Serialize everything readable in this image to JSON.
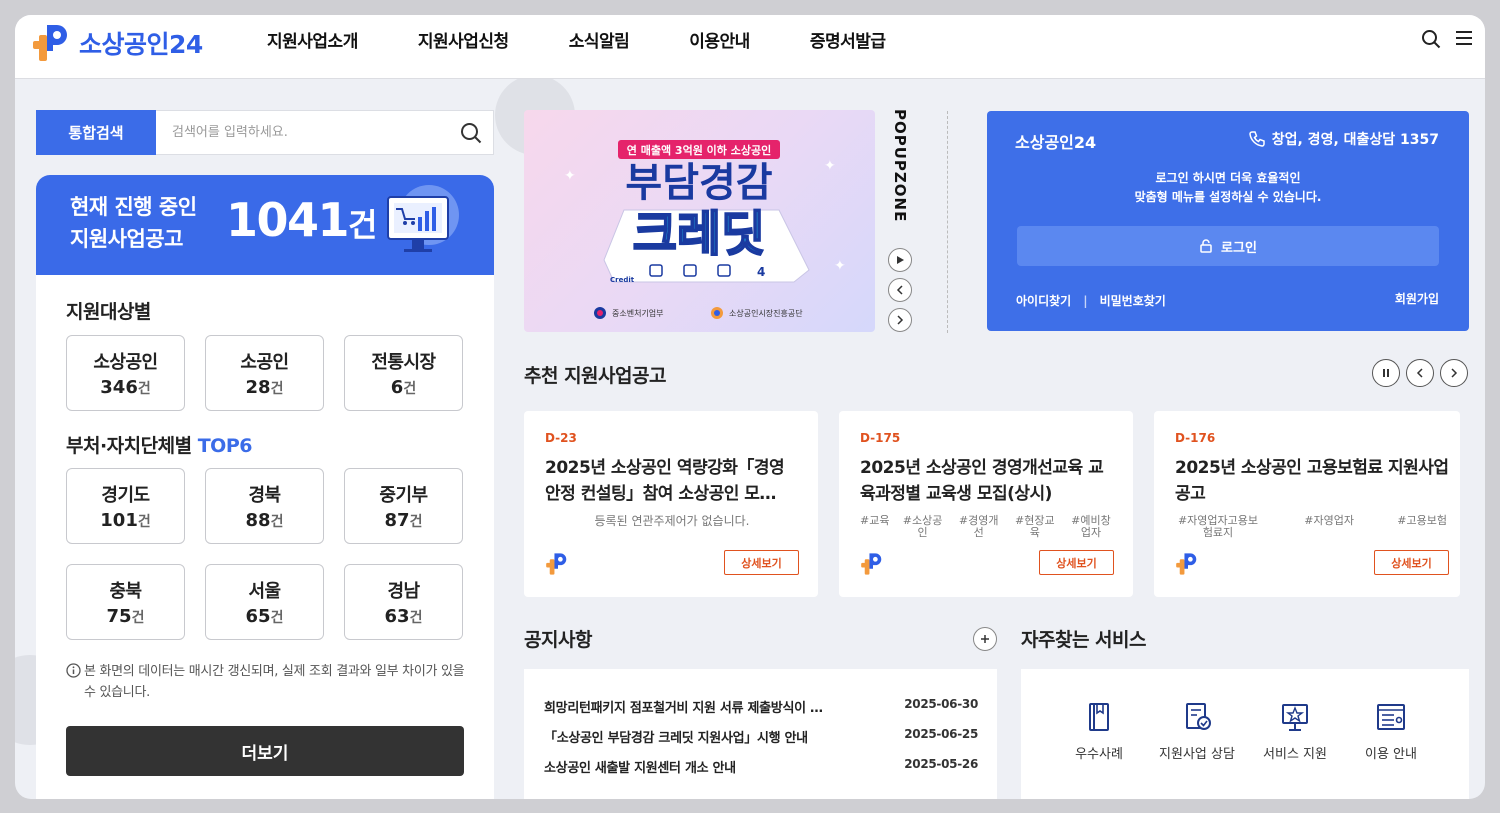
{
  "header": {
    "logo_text": "소상공인24",
    "nav": [
      "지원사업소개",
      "지원사업신청",
      "소식알림",
      "이용안내",
      "증명서발급"
    ],
    "icons": [
      "search-icon",
      "menu-icon"
    ]
  },
  "search": {
    "label": "통합검색",
    "placeholder": "검색어를 입력하세요."
  },
  "ongoing": {
    "label_line1": "현재 진행 중인",
    "label_line2": "지원사업공고",
    "count": "1041",
    "unit": "건"
  },
  "targets": {
    "title": "지원대상별",
    "items": [
      {
        "name": "소상공인",
        "count": "346",
        "unit": "건"
      },
      {
        "name": "소공인",
        "count": "28",
        "unit": "건"
      },
      {
        "name": "전통시장",
        "count": "6",
        "unit": "건"
      }
    ]
  },
  "agencies": {
    "title_prefix": "부처·자치단체별",
    "title_highlight": "TOP6",
    "items": [
      {
        "name": "경기도",
        "count": "101",
        "unit": "건"
      },
      {
        "name": "경북",
        "count": "88",
        "unit": "건"
      },
      {
        "name": "중기부",
        "count": "87",
        "unit": "건"
      },
      {
        "name": "충북",
        "count": "75",
        "unit": "건"
      },
      {
        "name": "서울",
        "count": "65",
        "unit": "건"
      },
      {
        "name": "경남",
        "count": "63",
        "unit": "건"
      }
    ]
  },
  "data_notice": "본 화면의 데이터는 매시간 갱신되며, 실제 조회 결과와 일부 차이가 있을 수 있습니다.",
  "more_button": "더보기",
  "popup": {
    "zone_label": "POPUPZONE",
    "badge": "연 매출액 3억원 이하 소상공인",
    "headline1": "부담경감",
    "headline2": "크레딧",
    "card_text": "Credit",
    "sponsor1": "중소벤처기업부",
    "sponsor2": "소상공인시장진흥공단"
  },
  "login": {
    "brand": "소상공인24",
    "phone": "창업, 경영, 대출상담 1357",
    "message_line1": "로그인 하시면 더욱 효율적인",
    "message_line2": "맞춤형 메뉴를 설정하실 수 있습니다.",
    "button": "로그인",
    "find_id": "아이디찾기",
    "find_pw": "비밀번호찾기",
    "join": "회원가입"
  },
  "recommended": {
    "title": "추천 지원사업공고",
    "cards": [
      {
        "dday": "D-23",
        "title": "2025년 소상공인 역량강화「경영안정 컨설팅」참여 소상공인 모…",
        "tags": [],
        "no_topic": "등록된 연관주제어가 없습니다.",
        "button": "상세보기"
      },
      {
        "dday": "D-175",
        "title": "2025년 소상공인 경영개선교육 교육과정별 교육생 모집(상시)",
        "tags": [
          "#교육",
          "#소상공인",
          "#경영개선",
          "#현장교육",
          "#예비창업자"
        ],
        "no_topic": "",
        "button": "상세보기"
      },
      {
        "dday": "D-176",
        "title": "2025년 소상공인 고용보험료 지원사업 공고",
        "tags": [
          "#자영업자고용보험료지",
          "#자영업자",
          "#고용보험"
        ],
        "no_topic": "",
        "button": "상세보기"
      }
    ]
  },
  "notices": {
    "title": "공지사항",
    "items": [
      {
        "title": "희망리턴패키지 점포철거비 지원 서류 제출방식이 …",
        "date": "2025-06-30"
      },
      {
        "title": "「소상공인 부담경감 크레딧 지원사업」시행 안내",
        "date": "2025-06-25"
      },
      {
        "title": "소상공인 새출발 지원센터 개소 안내",
        "date": "2025-05-26"
      }
    ]
  },
  "services": {
    "title": "자주찾는 서비스",
    "items": [
      {
        "label": "우수사례",
        "icon": "book-icon"
      },
      {
        "label": "지원사업 상담",
        "icon": "consult-icon"
      },
      {
        "label": "서비스 지원",
        "icon": "award-icon"
      },
      {
        "label": "이용 안내",
        "icon": "guide-icon"
      }
    ]
  },
  "colors": {
    "primary": "#3b6ce8",
    "accent": "#e0521f",
    "logo_orange": "#f39a3d",
    "dark_button": "#333333"
  }
}
